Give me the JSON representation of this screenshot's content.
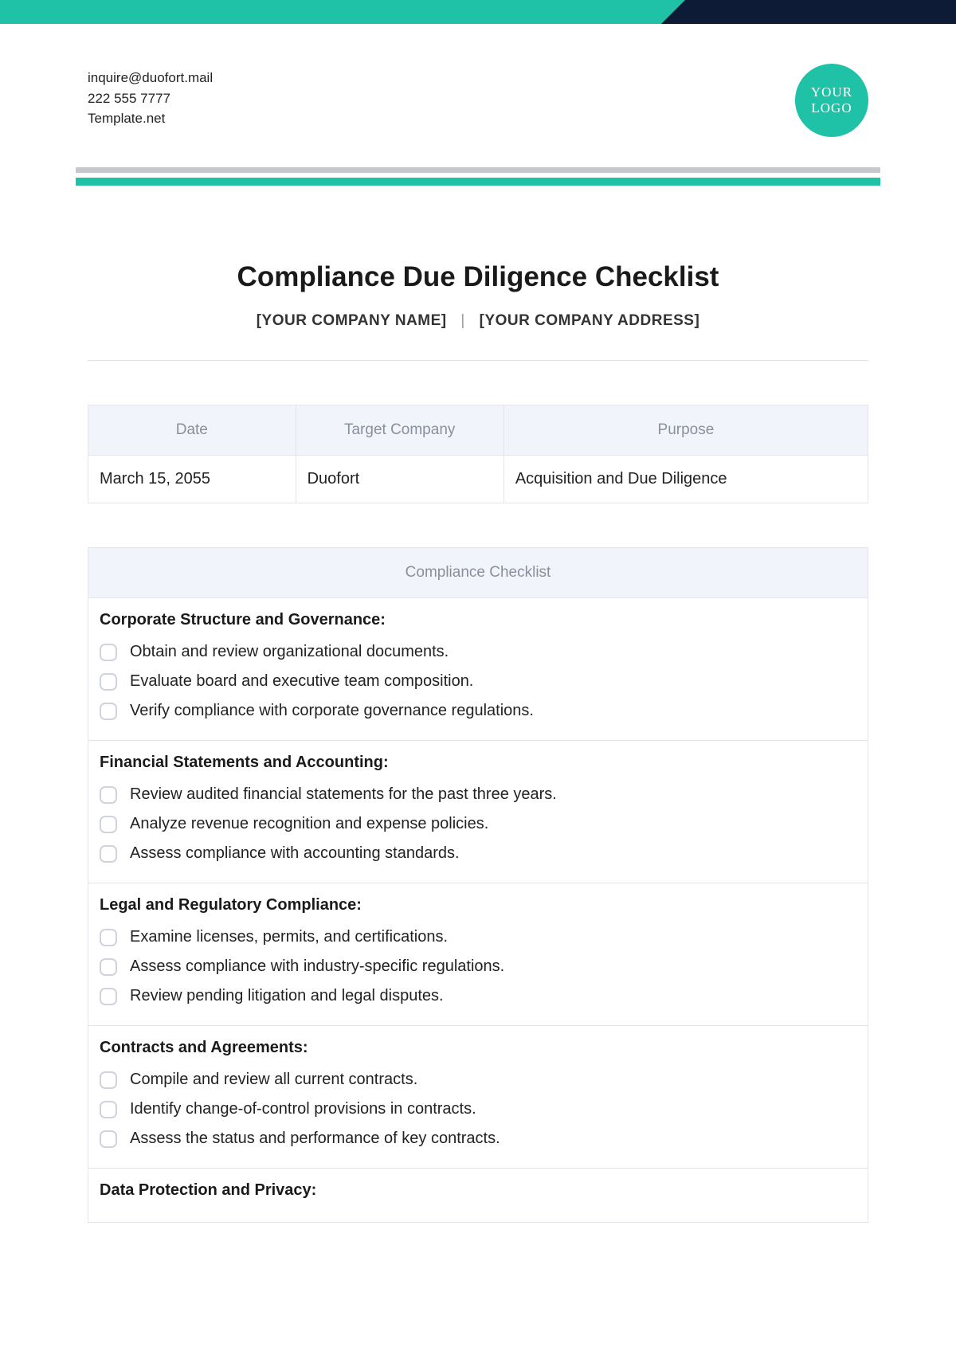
{
  "header": {
    "email": "inquire@duofort.mail",
    "phone": "222 555 7777",
    "site": "Template.net",
    "logo_line1": "YOUR",
    "logo_line2": "LOGO"
  },
  "document": {
    "title": "Compliance Due Diligence Checklist",
    "company_name_placeholder": "[YOUR COMPANY NAME]",
    "company_address_placeholder": "[YOUR COMPANY ADDRESS]"
  },
  "info_table": {
    "headers": {
      "date": "Date",
      "target_company": "Target Company",
      "purpose": "Purpose"
    },
    "row": {
      "date": "March 15, 2055",
      "target_company": "Duofort",
      "purpose": "Acquisition and Due Diligence"
    }
  },
  "checklist": {
    "header": "Compliance Checklist",
    "sections": [
      {
        "heading": "Corporate Structure and Governance:",
        "items": [
          "Obtain and review organizational documents.",
          "Evaluate board and executive team composition.",
          "Verify compliance with corporate governance regulations."
        ]
      },
      {
        "heading": "Financial Statements and Accounting:",
        "items": [
          "Review audited financial statements for the past three years.",
          "Analyze revenue recognition and expense policies.",
          "Assess compliance with accounting standards."
        ]
      },
      {
        "heading": "Legal and Regulatory Compliance:",
        "items": [
          "Examine licenses, permits, and certifications.",
          "Assess compliance with industry-specific regulations.",
          "Review pending litigation and legal disputes."
        ]
      },
      {
        "heading": "Contracts and Agreements:",
        "items": [
          "Compile and review all current contracts.",
          "Identify change-of-control provisions in contracts.",
          "Assess the status and performance of key contracts."
        ]
      },
      {
        "heading": "Data Protection and Privacy:",
        "items": []
      }
    ]
  }
}
